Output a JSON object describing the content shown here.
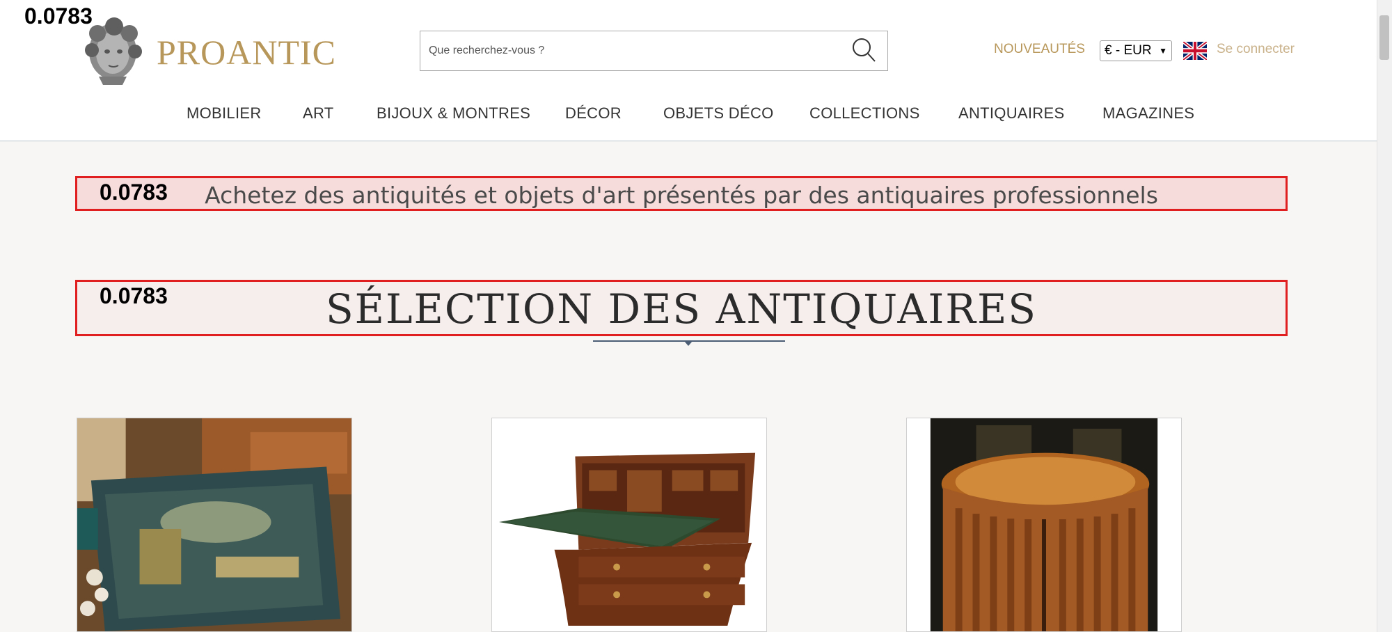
{
  "debug": {
    "score": "0.0783"
  },
  "header": {
    "logo_text": "PROANTIC",
    "search_placeholder": "Que recherchez-vous ?",
    "new_label": "NOUVEAUTÉS",
    "currency_selected": "€ - EUR",
    "login_label": "Se connecter",
    "colors": {
      "brand_gold": "#b8975a",
      "login_gold": "#c9b18a"
    }
  },
  "nav": {
    "items": [
      "MOBILIER",
      "ART",
      "BIJOUX & MONTRES",
      "DÉCOR",
      "OBJETS DÉCO",
      "COLLECTIONS",
      "ANTIQUAIRES",
      "MAGAZINES"
    ]
  },
  "main": {
    "tagline": "Achetez des antiquités et objets d'art présentés par des antiquaires professionnels",
    "section_title": "SÉLECTION DES ANTIQUAIRES",
    "cards": [
      {
        "icon": "lacquered-box-image"
      },
      {
        "icon": "bureau-desk-image"
      },
      {
        "icon": "demilune-commode-image"
      }
    ]
  }
}
